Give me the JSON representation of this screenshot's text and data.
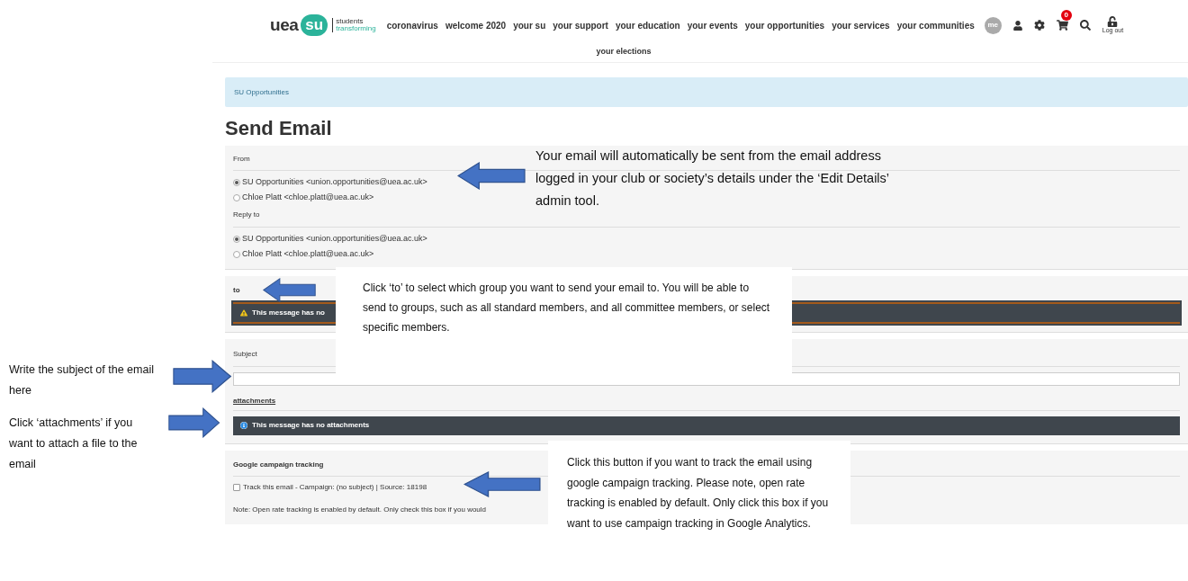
{
  "header": {
    "logo": {
      "wordmark": "uea",
      "badge": "su",
      "tagline_1": "students",
      "tagline_2": "transforming"
    },
    "nav": [
      "coronavirus",
      "welcome 2020",
      "your su",
      "your support",
      "your education",
      "your events",
      "your opportunities",
      "your services",
      "your communities"
    ],
    "nav_row_2": [
      "your elections"
    ],
    "me_badge": "me",
    "cart_count": "0",
    "logout": "Log out"
  },
  "breadcrumb": "SU Opportunities",
  "title": "Send Email",
  "from": {
    "label": "From",
    "options": [
      {
        "label": "SU Opportunities <union.opportunities@uea.ac.uk>",
        "selected": true
      },
      {
        "label": "Chloe Platt <chloe.platt@uea.ac.uk>",
        "selected": false
      }
    ]
  },
  "reply_to": {
    "label": "Reply to",
    "options": [
      {
        "label": "SU Opportunities <union.opportunities@uea.ac.uk>",
        "selected": true
      },
      {
        "label": "Chloe Platt <chloe.platt@uea.ac.uk>",
        "selected": false
      }
    ]
  },
  "to": {
    "label": "to",
    "warning": "This message has no"
  },
  "subject": {
    "label": "Subject"
  },
  "attachments": {
    "label": "attachments",
    "info": "This message has no attachments"
  },
  "tracking": {
    "heading": "Google campaign tracking",
    "checkbox": {
      "label": "Track this email - Campaign: (no subject) | Source: 18198",
      "checked": false
    },
    "note": "Note: Open rate tracking is enabled by default. Only check this box if you would"
  },
  "annotations": {
    "from_note": "Your email will automatically be sent from the email address logged in your club or society’s details under the ‘Edit Details’ admin tool.",
    "to_note": "Click ‘to’ to select which group you want to send your email to. You will be able to send to groups, such as all standard members, and all committee members, or select specific members.",
    "subject_note": "Write the subject of the email here",
    "attachments_note": "Click ‘attachments’ if you want to attach a file to the email",
    "tracking_note": "Click this button if you want to track the email using google campaign tracking. Please note, open rate tracking is enabled by default. Only click this box if you want to use campaign tracking in Google Analytics."
  }
}
